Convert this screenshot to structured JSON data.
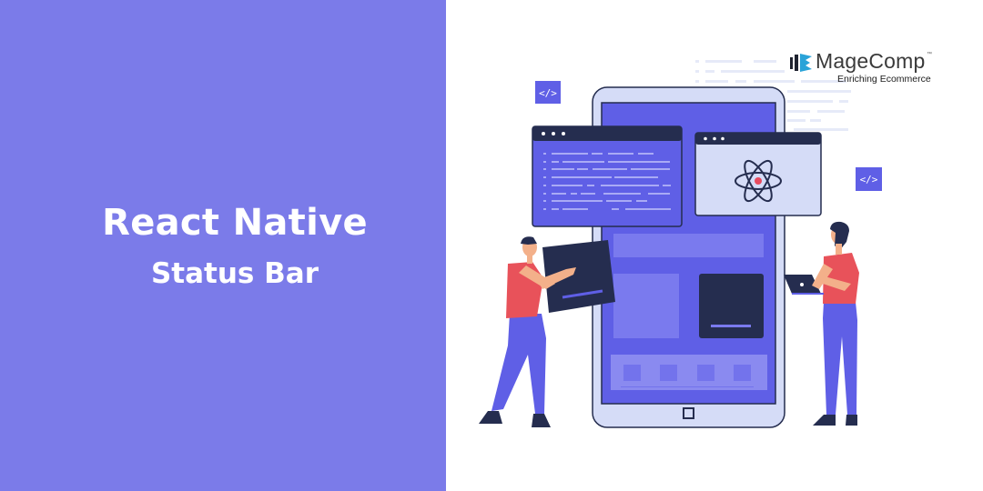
{
  "banner": {
    "title_line1": "React Native",
    "title_line2": "Status Bar",
    "background_color": "#7b7be9",
    "text_color": "#ffffff"
  },
  "brand": {
    "name": "MageComp",
    "trademark": "™",
    "tagline": "Enriching Ecommerce",
    "logo_icon": "magecomp-logo-icon"
  },
  "illustration": {
    "subject": "developers building a mobile app",
    "code_badge_label": "</>",
    "icons": [
      "code-tag-icon",
      "react-atom-icon",
      "phone-home-button-icon",
      "laptop-icon"
    ],
    "colors": {
      "primary": "#5f5fe6",
      "navy": "#252d4f",
      "light_panel": "#d5dcf7",
      "shirt": "#e8525a",
      "atom_dot": "#e84a5f"
    }
  }
}
